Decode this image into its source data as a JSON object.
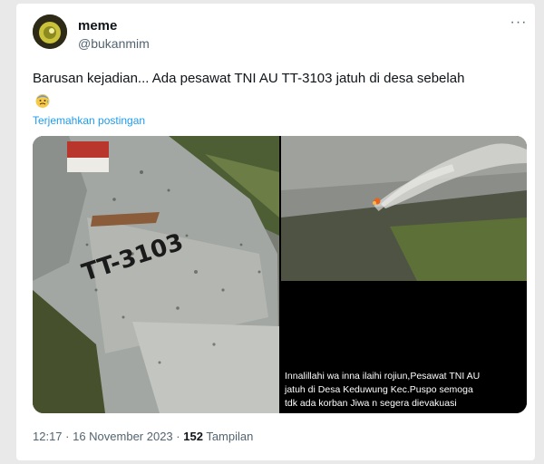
{
  "author": {
    "display_name": "meme",
    "handle": "@bukanmim"
  },
  "tweet": {
    "text": "Barusan kejadian... Ada pesawat TNI AU TT-3103 jatuh di desa sebelah",
    "translate_label": "Terjemahkan postingan"
  },
  "media": {
    "tail_marking": "TT-3103",
    "caption_lines": [
      "Innalillahi wa inna ilaihi rojiun,Pesawat TNI AU",
      "jatuh di Desa Keduwung Kec.Puspo semoga",
      "tdk ada korban Jiwa n segera dievakuasi"
    ]
  },
  "meta": {
    "time_date": "12:17 · 16 November 2023 ·",
    "views_count": "152",
    "views_label": "Tampilan"
  },
  "icons": {
    "more": "more-icon",
    "emoji": "anxious-face-emoji",
    "avatar": "avatar-icon"
  },
  "colors": {
    "link": "#1d9bf0",
    "secondary_text": "#536471",
    "primary_text": "#0f1419"
  }
}
